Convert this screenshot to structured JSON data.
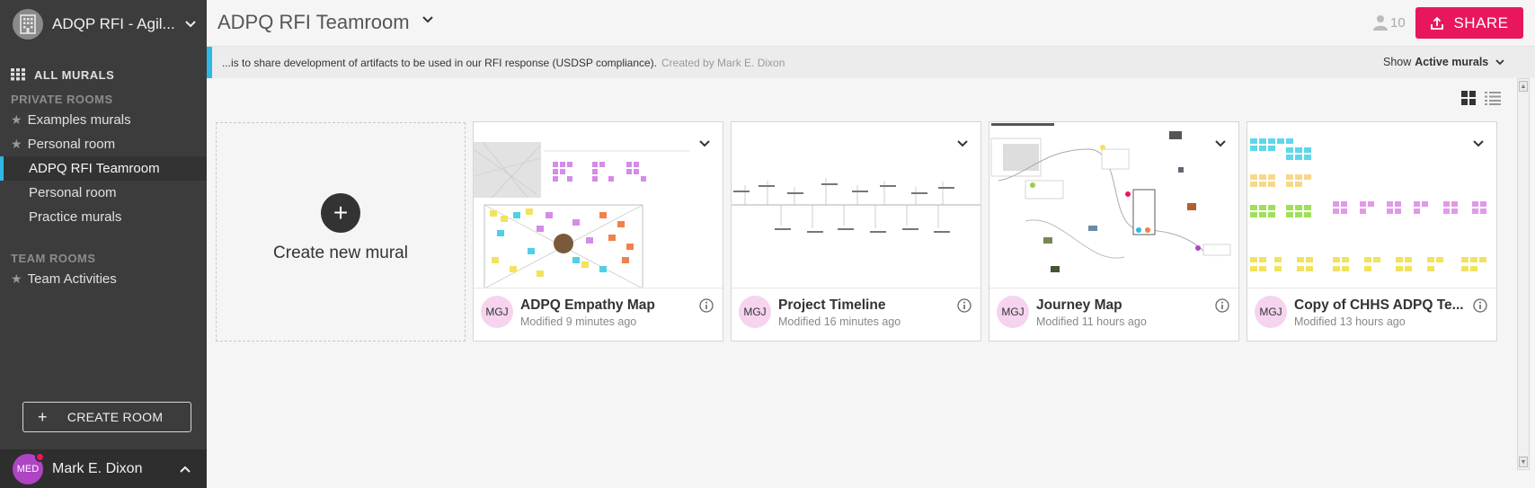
{
  "workspace": {
    "name": "ADQP RFI - Agil..."
  },
  "sidebar": {
    "all_murals": "ALL MURALS",
    "private_label": "PRIVATE ROOMS",
    "private_items": [
      "Examples murals",
      "Personal room"
    ],
    "sub_items": [
      "ADPQ RFI Teamroom",
      "Personal room",
      "Practice murals"
    ],
    "team_label": "TEAM ROOMS",
    "team_items": [
      "Team Activities"
    ],
    "create_room": "CREATE ROOM"
  },
  "user": {
    "initials": "MED",
    "name": "Mark E. Dixon"
  },
  "header": {
    "room_title": "ADPQ RFI Teamroom",
    "member_count": "10",
    "share_label": "SHARE"
  },
  "description": {
    "text": "...is to share development of artifacts to be used in our RFI response (USDSP compliance).",
    "created_by": "Created by Mark E. Dixon",
    "show_label": "Show",
    "show_value": "Active murals"
  },
  "create_mural": {
    "label": "Create new mural"
  },
  "murals": [
    {
      "title": "ADPQ Empathy Map",
      "modified": "Modified 9 minutes ago",
      "initials": "MGJ"
    },
    {
      "title": "Project Timeline",
      "modified": "Modified 16 minutes ago",
      "initials": "MGJ"
    },
    {
      "title": "Journey Map",
      "modified": "Modified 11 hours ago",
      "initials": "MGJ"
    },
    {
      "title": "Copy of CHHS ADPQ Te...",
      "modified": "Modified 13 hours ago",
      "initials": "MGJ"
    }
  ],
  "colors": {
    "accent": "#e8175d",
    "highlight": "#2fb8e6",
    "sidebar": "#3c3c3c"
  },
  "icons": [
    "building-icon",
    "grid-icon",
    "star-icon",
    "plus-icon",
    "user-icon",
    "share-icon",
    "chevron-down-icon",
    "chevron-up-icon",
    "info-icon",
    "grid-view-icon",
    "list-view-icon"
  ]
}
